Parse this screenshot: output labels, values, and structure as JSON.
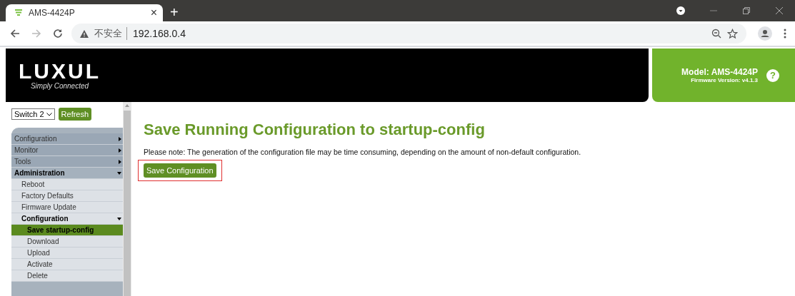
{
  "browser": {
    "tab": {
      "title": "AMS-4424P",
      "close": "×"
    },
    "new_tab": "+",
    "security": "不安全",
    "url": "192.168.0.4"
  },
  "header": {
    "logo": "LUXUL",
    "tagline": "Simply Connected",
    "model": "Model: AMS-4424P",
    "firmware": "Firmware Version: v4.1.3",
    "help": "?"
  },
  "sidebar": {
    "switch_select": {
      "value": "Switch 2"
    },
    "refresh_button": "Refresh",
    "menu": [
      {
        "label": "Configuration",
        "expanded": false,
        "selected": false
      },
      {
        "label": "Monitor",
        "expanded": false,
        "selected": false
      },
      {
        "label": "Tools",
        "expanded": false,
        "selected": false
      },
      {
        "label": "Administration",
        "expanded": true,
        "selected": false,
        "children": [
          {
            "label": "Reboot",
            "selected": false
          },
          {
            "label": "Factory Defaults",
            "selected": false
          },
          {
            "label": "Firmware Update",
            "selected": false
          },
          {
            "label": "Configuration",
            "expanded": true,
            "selected": false,
            "children": [
              {
                "label": "Save startup-config",
                "selected": true
              },
              {
                "label": "Download",
                "selected": false
              },
              {
                "label": "Upload",
                "selected": false
              },
              {
                "label": "Activate",
                "selected": false
              },
              {
                "label": "Delete",
                "selected": false
              }
            ]
          }
        ]
      }
    ]
  },
  "main": {
    "title": "Save Running Configuration to startup-config",
    "note": "Please note: The generation of the configuration file may be time consuming, depending on the amount of non-default configuration.",
    "save_button": {
      "label": "Save Configuration",
      "highlighted": true
    }
  }
}
